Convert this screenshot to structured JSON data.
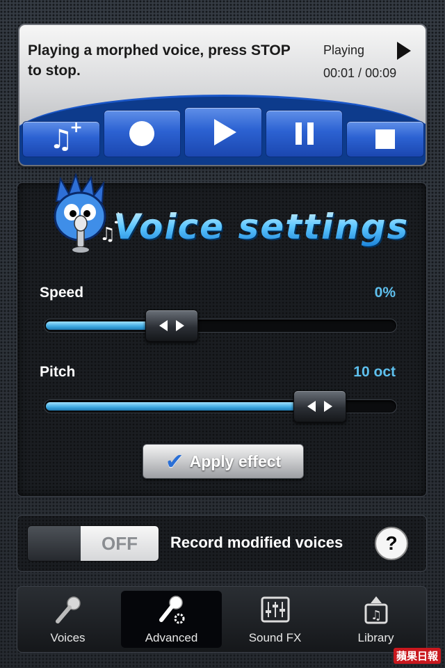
{
  "player": {
    "status_text": "Playing a morphed voice, press STOP to stop.",
    "state": "Playing",
    "elapsed": "00:01",
    "separator": " / ",
    "total": "00:09",
    "buttons": [
      {
        "icon": "add-music-icon"
      },
      {
        "icon": "record-icon"
      },
      {
        "icon": "play-icon"
      },
      {
        "icon": "pause-icon"
      },
      {
        "icon": "stop-icon"
      }
    ]
  },
  "settings": {
    "title": "Voice settings",
    "speed": {
      "label": "Speed",
      "value": "0%",
      "fill_fraction": 0.36
    },
    "pitch": {
      "label": "Pitch",
      "value": "10 oct",
      "fill_fraction": 0.78
    },
    "apply_label": "Apply effect"
  },
  "record": {
    "toggle_state": "OFF",
    "label": "Record modified voices",
    "help": "?"
  },
  "tabs": [
    {
      "label": "Voices",
      "icon": "microphone-icon",
      "active": false
    },
    {
      "label": "Advanced",
      "icon": "microphone-gear-icon",
      "active": true
    },
    {
      "label": "Sound FX",
      "icon": "equalizer-icon",
      "active": false
    },
    {
      "label": "Library",
      "icon": "library-icon",
      "active": false
    }
  ],
  "watermark": "蘋果日報",
  "colors": {
    "accent_blue": "#2c62d2",
    "value_blue": "#5ec0ee",
    "title_blue": "#5cc6ff"
  }
}
